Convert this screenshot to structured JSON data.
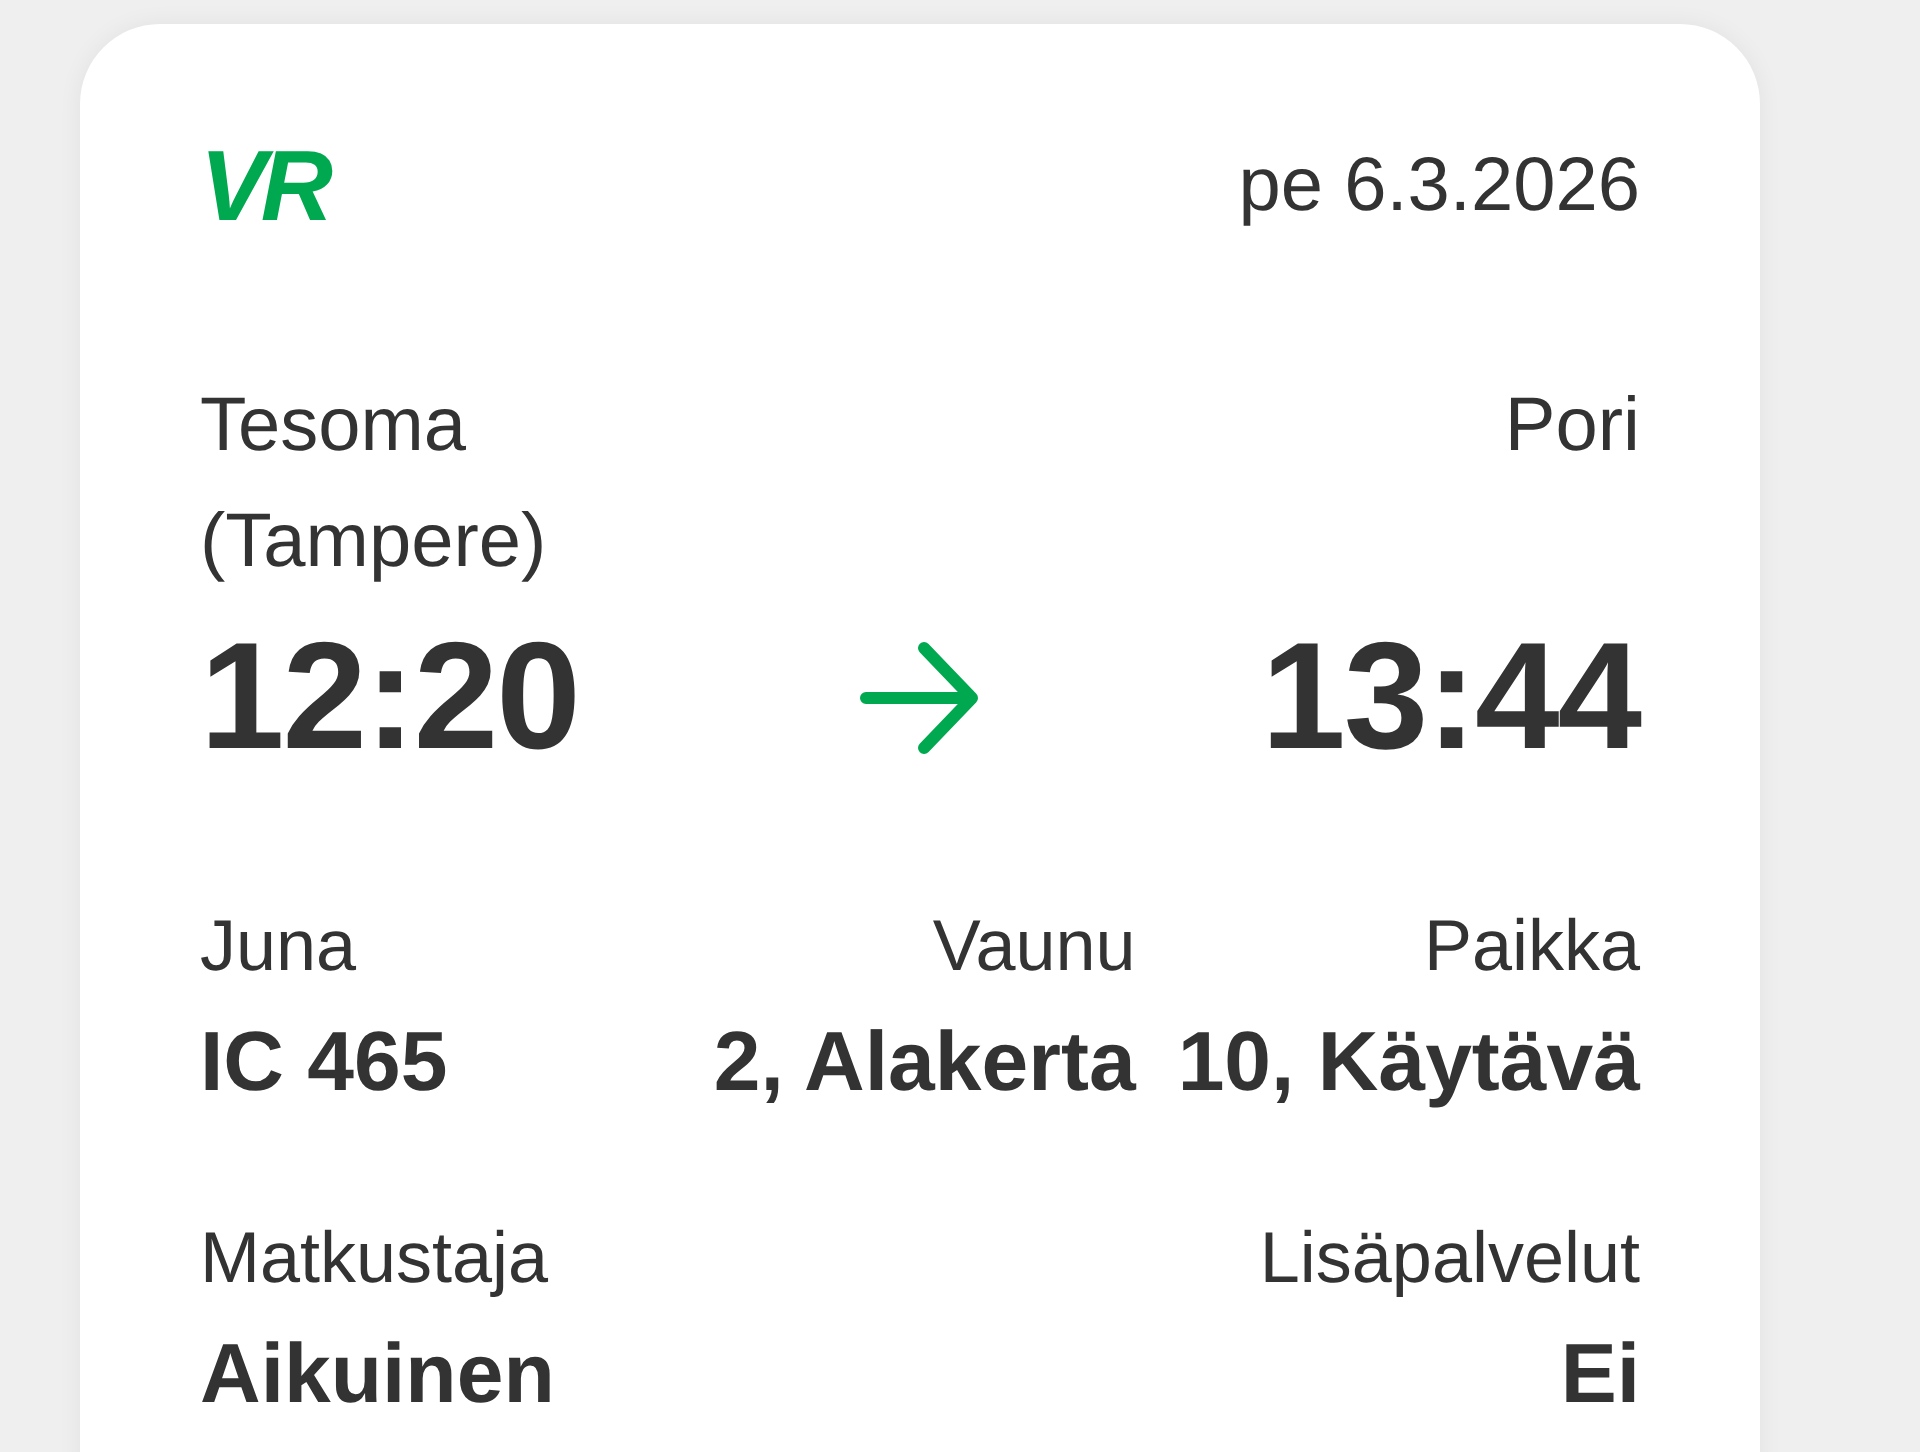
{
  "header": {
    "logo": "VR",
    "date": "pe 6.3.2026"
  },
  "journey": {
    "departure": {
      "station": "Tesoma (Tampere)",
      "time": "12:20"
    },
    "arrival": {
      "station": "Pori",
      "time": "13:44"
    }
  },
  "details": [
    {
      "label": "Juna",
      "value": "IC 465"
    },
    {
      "label": "Vaunu",
      "value": "2, Alakerta"
    },
    {
      "label": "Paikka",
      "value": "10, Käytävä"
    }
  ],
  "passenger": [
    {
      "label": "Matkustaja",
      "value": "Aikuinen"
    },
    {
      "label": "Lisäpalvelut",
      "value": "Ei"
    }
  ]
}
